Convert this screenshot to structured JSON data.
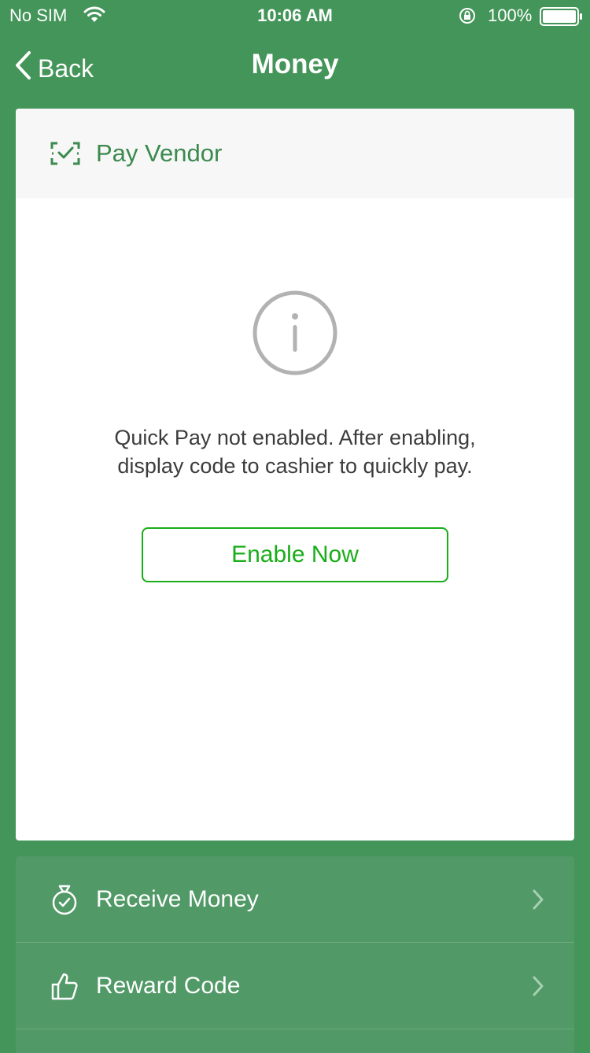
{
  "status_bar": {
    "carrier": "No SIM",
    "time": "10:06 AM",
    "battery": "100%"
  },
  "nav": {
    "back_label": "Back",
    "title": "Money"
  },
  "card": {
    "header_title": "Pay Vendor",
    "message_line1": "Quick Pay not enabled. After enabling,",
    "message_line2": "display code to cashier to quickly pay.",
    "enable_button": "Enable Now"
  },
  "list": {
    "items": [
      {
        "label": "Receive Money",
        "icon": "money-bag-icon"
      },
      {
        "label": "Reward Code",
        "icon": "thumbs-up-icon"
      }
    ]
  },
  "colors": {
    "background": "#449559",
    "accent_green": "#1aad19",
    "header_text": "#3b8a4e",
    "list_background": "#519966"
  }
}
